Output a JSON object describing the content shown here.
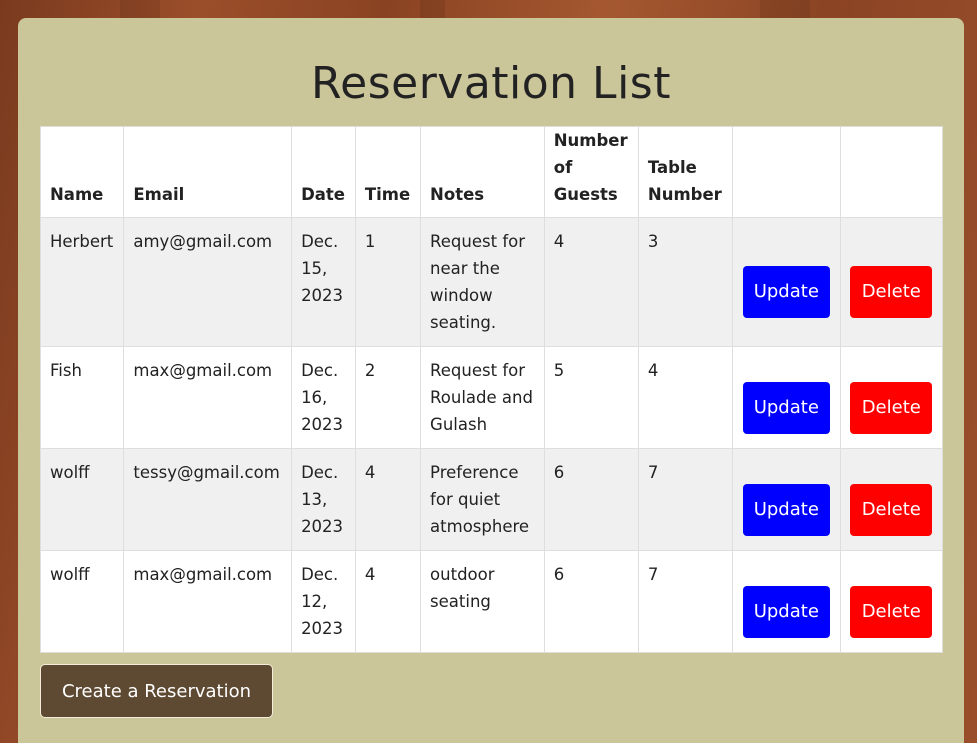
{
  "page": {
    "title": "Reservation List"
  },
  "table": {
    "headers": [
      "Name",
      "Email",
      "Date",
      "Time",
      "Notes",
      "Number of Guests",
      "Table Number",
      "",
      ""
    ],
    "rows": [
      {
        "name": "Herbert",
        "email": "amy@gmail.com",
        "date": "Dec. 15, 2023",
        "time": "1",
        "notes": "Request for near the window seating.",
        "guests": "4",
        "table": "3",
        "update_label": "Update",
        "delete_label": "Delete"
      },
      {
        "name": "Fish",
        "email": "max@gmail.com",
        "date": "Dec. 16, 2023",
        "time": "2",
        "notes": "Request for Roulade and Gulash",
        "guests": "5",
        "table": "4",
        "update_label": "Update",
        "delete_label": "Delete"
      },
      {
        "name": "wolff",
        "email": "tessy@gmail.com",
        "date": "Dec. 13, 2023",
        "time": "4",
        "notes": "Preference for quiet atmosphere",
        "guests": "6",
        "table": "7",
        "update_label": "Update",
        "delete_label": "Delete"
      },
      {
        "name": "wolff",
        "email": "max@gmail.com",
        "date": "Dec. 12, 2023",
        "time": "4",
        "notes": "outdoor seating",
        "guests": "6",
        "table": "7",
        "update_label": "Update",
        "delete_label": "Delete"
      }
    ]
  },
  "actions": {
    "create_label": "Create a Reservation"
  },
  "colors": {
    "panel": "#cbc59a",
    "update_button": "#0000ff",
    "delete_button": "#ff0000",
    "create_button": "#5e4a32"
  }
}
